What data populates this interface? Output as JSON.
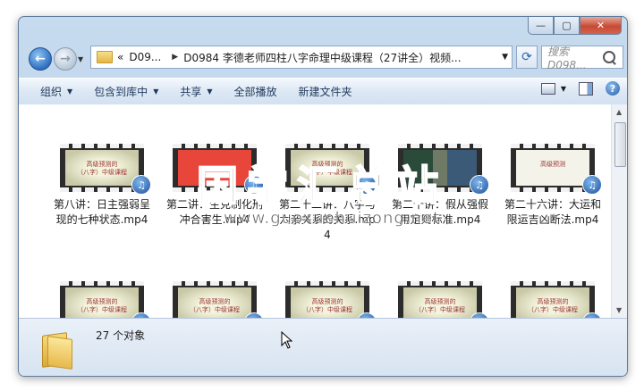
{
  "window": {
    "controls": {
      "minimize": "—",
      "maximize": "▢",
      "close": "✕"
    }
  },
  "nav": {
    "back_icon": "back-arrow-icon",
    "forward_icon": "forward-arrow-icon",
    "address": {
      "overflow": "«",
      "segments": [
        "D09...",
        "D0984 李德老师四柱八字命理中级课程（27讲全）视频..."
      ]
    },
    "search_placeholder": "搜索 D098..."
  },
  "toolbar": {
    "items": [
      {
        "label": "组织",
        "dropdown": true
      },
      {
        "label": "包含到库中",
        "dropdown": true
      },
      {
        "label": "共享",
        "dropdown": true
      },
      {
        "label": "全部播放",
        "dropdown": false
      },
      {
        "label": "新建文件夹",
        "dropdown": false
      }
    ]
  },
  "files": [
    {
      "name": "第八讲：日主强弱呈现的七种状态.mp4",
      "thumb": "slide",
      "slide_text": "高级预测的\n（八字）中级课程"
    },
    {
      "name": "第二讲：生克制化刑冲合害生.mp4",
      "thumb": "red",
      "slide_text": ""
    },
    {
      "name": "第二十二讲：八字与六亲关系的关系.mp4",
      "thumb": "slide",
      "slide_text": "高级预测的\n（八字）中级课程"
    },
    {
      "name": "第二十讲：假从强假用定则标准.mp4",
      "thumb": "photo",
      "slide_text": ""
    },
    {
      "name": "第二十六讲：大运和限运吉凶断法.mp4",
      "thumb": "slide2",
      "slide_text": "高级预测"
    },
    {
      "name": "",
      "thumb": "slide",
      "slide_text": "高级预测的\n（八字）中级课程"
    },
    {
      "name": "",
      "thumb": "slide",
      "slide_text": "高级预测的\n（八字）中级课程"
    },
    {
      "name": "",
      "thumb": "slide",
      "slide_text": "高级预测的\n（八字）中级课程"
    },
    {
      "name": "",
      "thumb": "slide",
      "slide_text": "高级预测的\n（八字）中级课程"
    },
    {
      "name": "",
      "thumb": "slide",
      "slide_text": "高级预测的\n（八字）中级课程"
    }
  ],
  "status": {
    "count": "27 个对象"
  },
  "watermark": {
    "text": "国学汇总站",
    "url": "www.guoxuehuizong.net"
  }
}
